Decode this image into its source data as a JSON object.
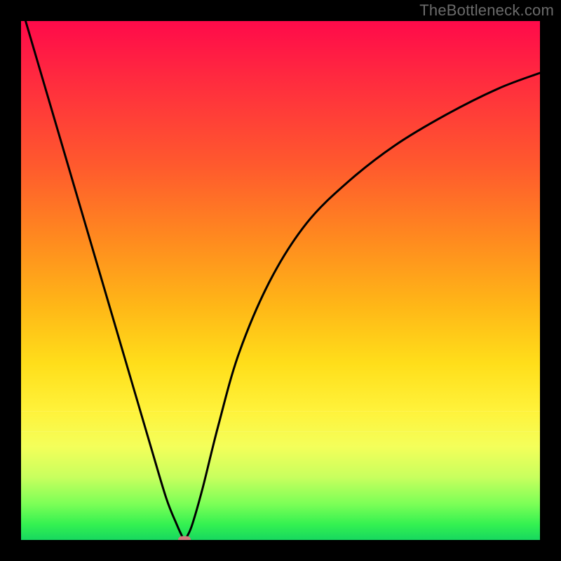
{
  "watermark": "TheBottleneck.com",
  "chart_data": {
    "type": "line",
    "title": "",
    "xlabel": "",
    "ylabel": "",
    "xlim": [
      0,
      100
    ],
    "ylim": [
      0,
      100
    ],
    "series": [
      {
        "name": "bottleneck-curve",
        "x": [
          0,
          5,
          10,
          15,
          20,
          25,
          28,
          30,
          31,
          31.5,
          32,
          33,
          35,
          38,
          42,
          48,
          55,
          63,
          72,
          82,
          92,
          100
        ],
        "values": [
          103,
          86,
          69,
          52,
          35,
          18,
          8,
          3,
          0.8,
          0,
          0.7,
          3,
          10,
          22,
          36,
          50,
          61,
          69,
          76,
          82,
          87,
          90
        ]
      }
    ],
    "marker": {
      "x": 31.5,
      "y": 0,
      "shape": "pill",
      "color": "#cf7a7e"
    },
    "background_gradient": {
      "stops": [
        {
          "pos": 0,
          "color": "#ff0a4a"
        },
        {
          "pos": 50,
          "color": "#ffb717"
        },
        {
          "pos": 80,
          "color": "#fff23a"
        },
        {
          "pos": 100,
          "color": "#17d85f"
        }
      ]
    },
    "grid": false,
    "legend": false
  }
}
